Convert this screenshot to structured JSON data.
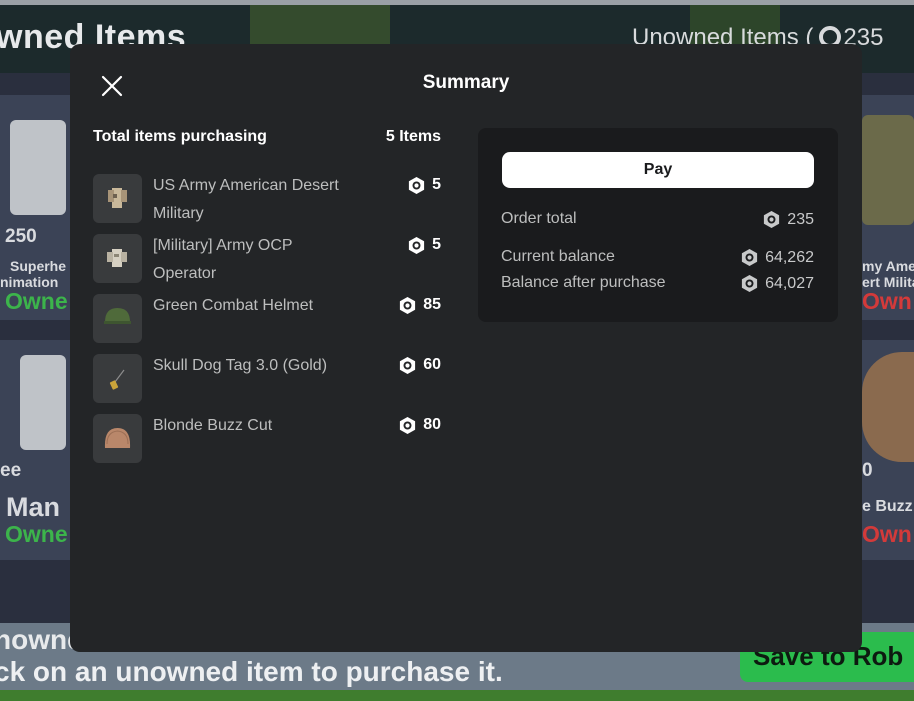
{
  "background": {
    "header_left": "wned Items",
    "header_right_label": "Unowned Items (",
    "header_right_value": "235",
    "card_price": "250",
    "card1_name": "Superhe",
    "card1_sub": "nimation",
    "owned_label": "Owne",
    "card2_name": "my Ame",
    "card2_sub": "ert Milita",
    "owned_label_right": "Own",
    "card3_label": "ee",
    "card3_name": "Man",
    "card4_label": "0",
    "card4_name": "e Buzz",
    "bottom_text1": "nowne",
    "bottom_text2": "ck on an unowned item to purchase it.",
    "save_button": "Save to Rob"
  },
  "modal": {
    "title": "Summary",
    "close_icon": "close-icon",
    "total_label": "Total items purchasing",
    "total_count": "5 Items",
    "items": [
      {
        "name": "US Army American Desert Military",
        "price": "5",
        "icon": "desert-uniform-icon"
      },
      {
        "name": "[Military] Army OCP Operator",
        "price": "5",
        "icon": "ocp-uniform-icon"
      },
      {
        "name": "Green Combat Helmet",
        "price": "85",
        "icon": "helmet-icon"
      },
      {
        "name": "Skull Dog Tag 3.0 (Gold)",
        "price": "60",
        "icon": "dog-tag-icon"
      },
      {
        "name": "Blonde Buzz Cut",
        "price": "80",
        "icon": "hair-icon"
      }
    ],
    "pay_label": "Pay",
    "order_total_label": "Order total",
    "order_total_value": "235",
    "current_balance_label": "Current balance",
    "current_balance_value": "64,262",
    "after_purchase_label": "Balance after purchase",
    "after_purchase_value": "64,027",
    "currency_icon": "robux-icon"
  },
  "colors": {
    "modal_bg": "#232527",
    "panel_bg": "#1a1b1d",
    "owned_green": "#3cb44b",
    "owned_red": "#d33a3a",
    "save_green": "#2bbc4d"
  }
}
